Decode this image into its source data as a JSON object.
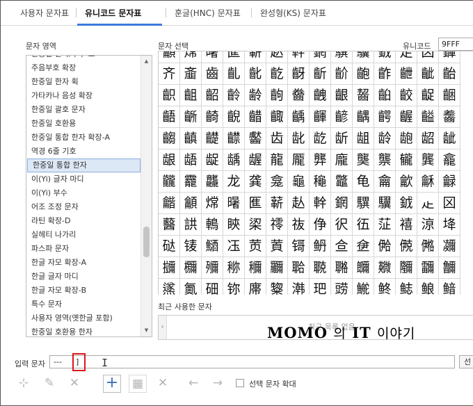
{
  "tabs": [
    {
      "label": "사용자 문자표",
      "active": false
    },
    {
      "label": "유니코드 문자표",
      "active": true
    },
    {
      "label": "훈글(HNC) 문자표",
      "active": false
    },
    {
      "label": "완성형(KS) 문자표",
      "active": false
    }
  ],
  "labels": {
    "char_region": "문자 영역",
    "char_select": "문자 선택",
    "unicode": "유니코드",
    "recent": "최근 사용한 문자",
    "recent_empty": "최근 목록 없음",
    "input": "입력 문자",
    "enlarge": "선택 문자 확대",
    "right_button": "선"
  },
  "unicode_value": "9FFF",
  "input_value": "---",
  "input_cursor_char": "]",
  "watermark": {
    "part1": "MOMO",
    "part2": "의",
    "part3": "IT",
    "part4": "이야기"
  },
  "regions": [
    "한중일 한자/부수 보",
    "주음부호 확장",
    "한중일 한자 획",
    "가타카나 음성 확장",
    "한중일 괄호 문자",
    "한중일 호환용",
    "한중일 통합 한자 확장-A",
    "역경 6줄 기호",
    "한중일 통합 한자",
    "이(Yi) 글자 마디",
    "이(Yi) 부수",
    "어조 조정 문자",
    "라틴 확장-D",
    "실헤티 나가리",
    "파스파 문자",
    "한글 자모 확장-A",
    "한글 글자 마디",
    "한글 자모 확장-B",
    "특수 문자",
    "사용자 영역(옛한글 포함)",
    "한중일 호환용 한자"
  ],
  "selected_region_index": 8,
  "grid_rows": [
    [
      "龥",
      "龦",
      "龧",
      "龨",
      "龩",
      "龪",
      "龫",
      "龬",
      "龭",
      "龮",
      "龯",
      "龰",
      "龱",
      "龲"
    ],
    [
      "齐",
      "齑",
      "齒",
      "齓",
      "齔",
      "齕",
      "齖",
      "齗",
      "齘",
      "齙",
      "齚",
      "齛",
      "齜",
      "齝"
    ],
    [
      "齞",
      "齟",
      "齠",
      "齡",
      "齢",
      "齣",
      "齤",
      "齥",
      "齦",
      "齧",
      "齨",
      "齩",
      "齪",
      "齫"
    ],
    [
      "齬",
      "齭",
      "齮",
      "齯",
      "齰",
      "齱",
      "齲",
      "齳",
      "齴",
      "齵",
      "齶",
      "齷",
      "齸",
      "齹"
    ],
    [
      "齺",
      "齻",
      "齼",
      "齽",
      "齾",
      "齿",
      "龀",
      "龁",
      "龂",
      "龃",
      "龄",
      "龅",
      "龆",
      "龇"
    ],
    [
      "龈",
      "龉",
      "龊",
      "龋",
      "龌",
      "龍",
      "龎",
      "龏",
      "龐",
      "龑",
      "龒",
      "龓",
      "龔",
      "龕"
    ],
    [
      "龖",
      "龗",
      "龘",
      "龙",
      "龚",
      "龛",
      "龜",
      "龝",
      "龞",
      "龟",
      "龠",
      "龡",
      "龢",
      "龣"
    ],
    [
      "龤",
      "龥",
      "龦",
      "龧",
      "龨",
      "龩",
      "龪",
      "龫",
      "龬",
      "龭",
      "龮",
      "龯",
      "龰",
      "龱"
    ],
    [
      "鿀",
      "鿁",
      "鿂",
      "鿃",
      "鿄",
      "鿅",
      "鿆",
      "鿇",
      "鿈",
      "鿉",
      "鿊",
      "鿋",
      "鿌",
      "鿍"
    ],
    [
      "鿎",
      "鿏",
      "鿐",
      "鿑",
      "鿒",
      "鿓",
      "鿔",
      "鿕",
      "鿖",
      "鿗",
      "鿘",
      "鿙",
      "鿚",
      "鿛"
    ],
    [
      "鿜",
      "鿝",
      "鿞",
      "鿟",
      "鿠",
      "鿡",
      "鿢",
      "鿣",
      "鿤",
      "鿥",
      "鿦",
      "鿧",
      "鿨",
      "鿩"
    ],
    [
      "鿪",
      "鿫",
      "鿬",
      "鿭",
      "鿮",
      "鿯",
      "鿰",
      "鿱",
      "鿲",
      "鿳",
      "鿴",
      "鿵",
      "鿶",
      "鿷"
    ]
  ]
}
